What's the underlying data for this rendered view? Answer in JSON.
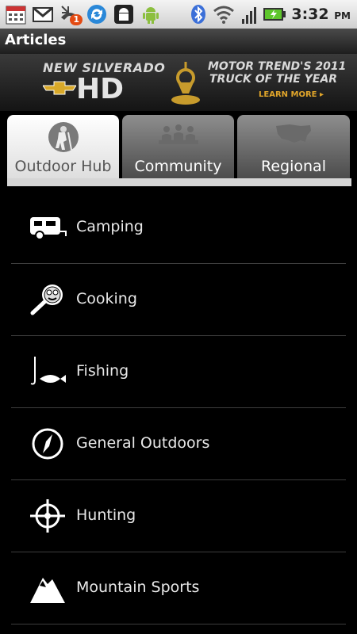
{
  "status_bar": {
    "time": "3:32",
    "ampm": "PM",
    "icons": [
      "calendar-icon",
      "gmail-icon",
      "missed-call-icon",
      "sync-icon",
      "android-icon",
      "android-robot-icon",
      "bluetooth-icon",
      "wifi-icon",
      "signal-icon",
      "battery-charging-icon"
    ],
    "notification_badge": "1"
  },
  "title_bar": {
    "title": "Articles"
  },
  "ad": {
    "line1": "NEW SILVERADO",
    "line2": "HD",
    "right1": "MOTOR TREND'S 2011",
    "right2": "TRUCK OF THE YEAR",
    "cta": "LEARN MORE ▸"
  },
  "tabs": [
    {
      "label": "Outdoor Hub",
      "icon": "hiker-icon",
      "active": true
    },
    {
      "label": "Community",
      "icon": "people-icon",
      "active": false
    },
    {
      "label": "Regional",
      "icon": "us-map-icon",
      "active": false
    }
  ],
  "categories": [
    {
      "label": "Camping",
      "icon": "camper-trailer-icon"
    },
    {
      "label": "Cooking",
      "icon": "frying-pan-icon"
    },
    {
      "label": "Fishing",
      "icon": "fish-hook-icon"
    },
    {
      "label": "General Outdoors",
      "icon": "compass-icon"
    },
    {
      "label": "Hunting",
      "icon": "crosshair-icon"
    },
    {
      "label": "Mountain Sports",
      "icon": "mountain-icon"
    }
  ]
}
